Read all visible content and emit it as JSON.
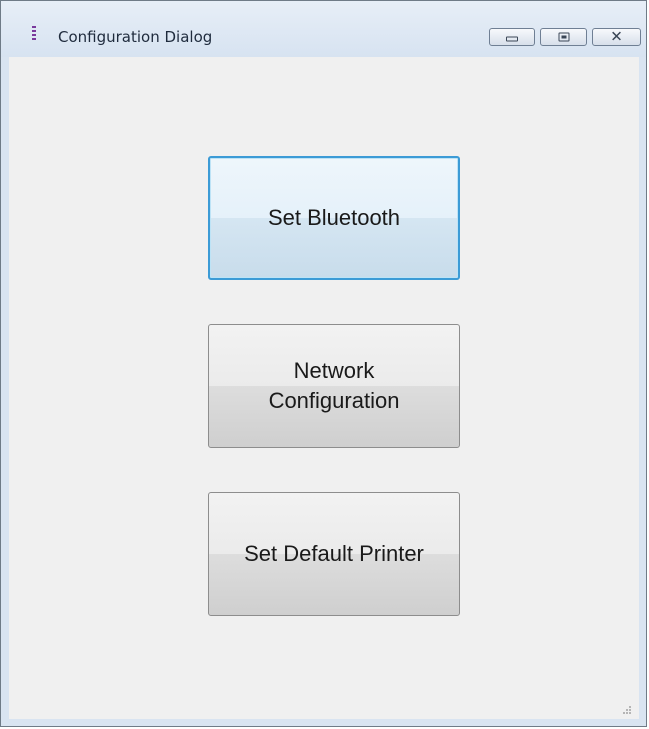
{
  "window": {
    "title": "Configuration Dialog",
    "icon": "app-icon"
  },
  "caption": {
    "minimize_icon": "minimize-icon",
    "maximize_icon": "maximize-icon",
    "close_icon": "close-icon"
  },
  "buttons": [
    {
      "label": "Set Bluetooth",
      "focused": true
    },
    {
      "label": "Network\nConfiguration",
      "focused": false
    },
    {
      "label": "Set Default Printer",
      "focused": false
    }
  ],
  "colors": {
    "focus_border": "#3c9bd6",
    "window_frame": "#d9e4f1",
    "client_background": "#f0f0f0"
  }
}
